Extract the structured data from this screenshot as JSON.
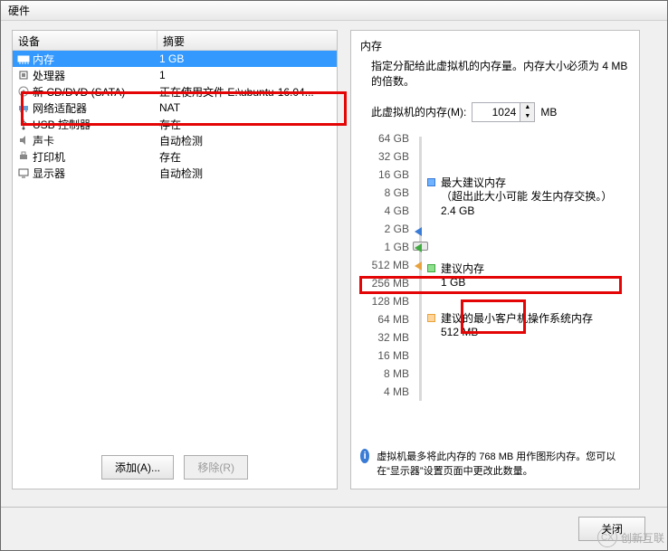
{
  "title": "硬件",
  "left": {
    "header_device": "设备",
    "header_summary": "摘要",
    "rows": [
      {
        "icon": "memory",
        "dev": "内存",
        "sum": "1 GB",
        "selected": true
      },
      {
        "icon": "cpu",
        "dev": "处理器",
        "sum": "1",
        "selected": false
      },
      {
        "icon": "disc",
        "dev": "新 CD/DVD (SATA)",
        "sum": "正在使用文件 E:\\ubuntu-16.04...",
        "selected": false
      },
      {
        "icon": "network",
        "dev": "网络适配器",
        "sum": "NAT",
        "selected": false
      },
      {
        "icon": "usb",
        "dev": "USB 控制器",
        "sum": "存在",
        "selected": false
      },
      {
        "icon": "sound",
        "dev": "声卡",
        "sum": "自动检测",
        "selected": false
      },
      {
        "icon": "printer",
        "dev": "打印机",
        "sum": "存在",
        "selected": false
      },
      {
        "icon": "display",
        "dev": "显示器",
        "sum": "自动检测",
        "selected": false
      }
    ],
    "add_btn": "添加(A)...",
    "remove_btn": "移除(R)"
  },
  "right": {
    "section": "内存",
    "desc": "指定分配给此虚拟机的内存量。内存大小必须为 4 MB 的倍数。",
    "mem_label": "此虚拟机的内存(M):",
    "mem_value": "1024",
    "mem_unit": "MB",
    "ticks": [
      "64 GB",
      "32 GB",
      "16 GB",
      "8 GB",
      "4 GB",
      "2 GB",
      "1 GB",
      "512 MB",
      "256 MB",
      "128 MB",
      "64 MB",
      "32 MB",
      "16 MB",
      "8 MB",
      "4 MB"
    ],
    "mark_max": "最大建议内存",
    "mark_max_sub": "（超出此大小可能 发生内存交换。）",
    "mark_max_val": "2.4 GB",
    "mark_rec": "建议内存",
    "mark_rec_val": "1 GB",
    "mark_min": "建议的最小客户机操作系统内存",
    "mark_min_val": "512 MB",
    "info": "虚拟机最多将此内存的 768 MB 用作图形内存。您可以在“显示器”设置页面中更改此数量。"
  },
  "close_btn": "关闭",
  "watermark": "创新互联"
}
